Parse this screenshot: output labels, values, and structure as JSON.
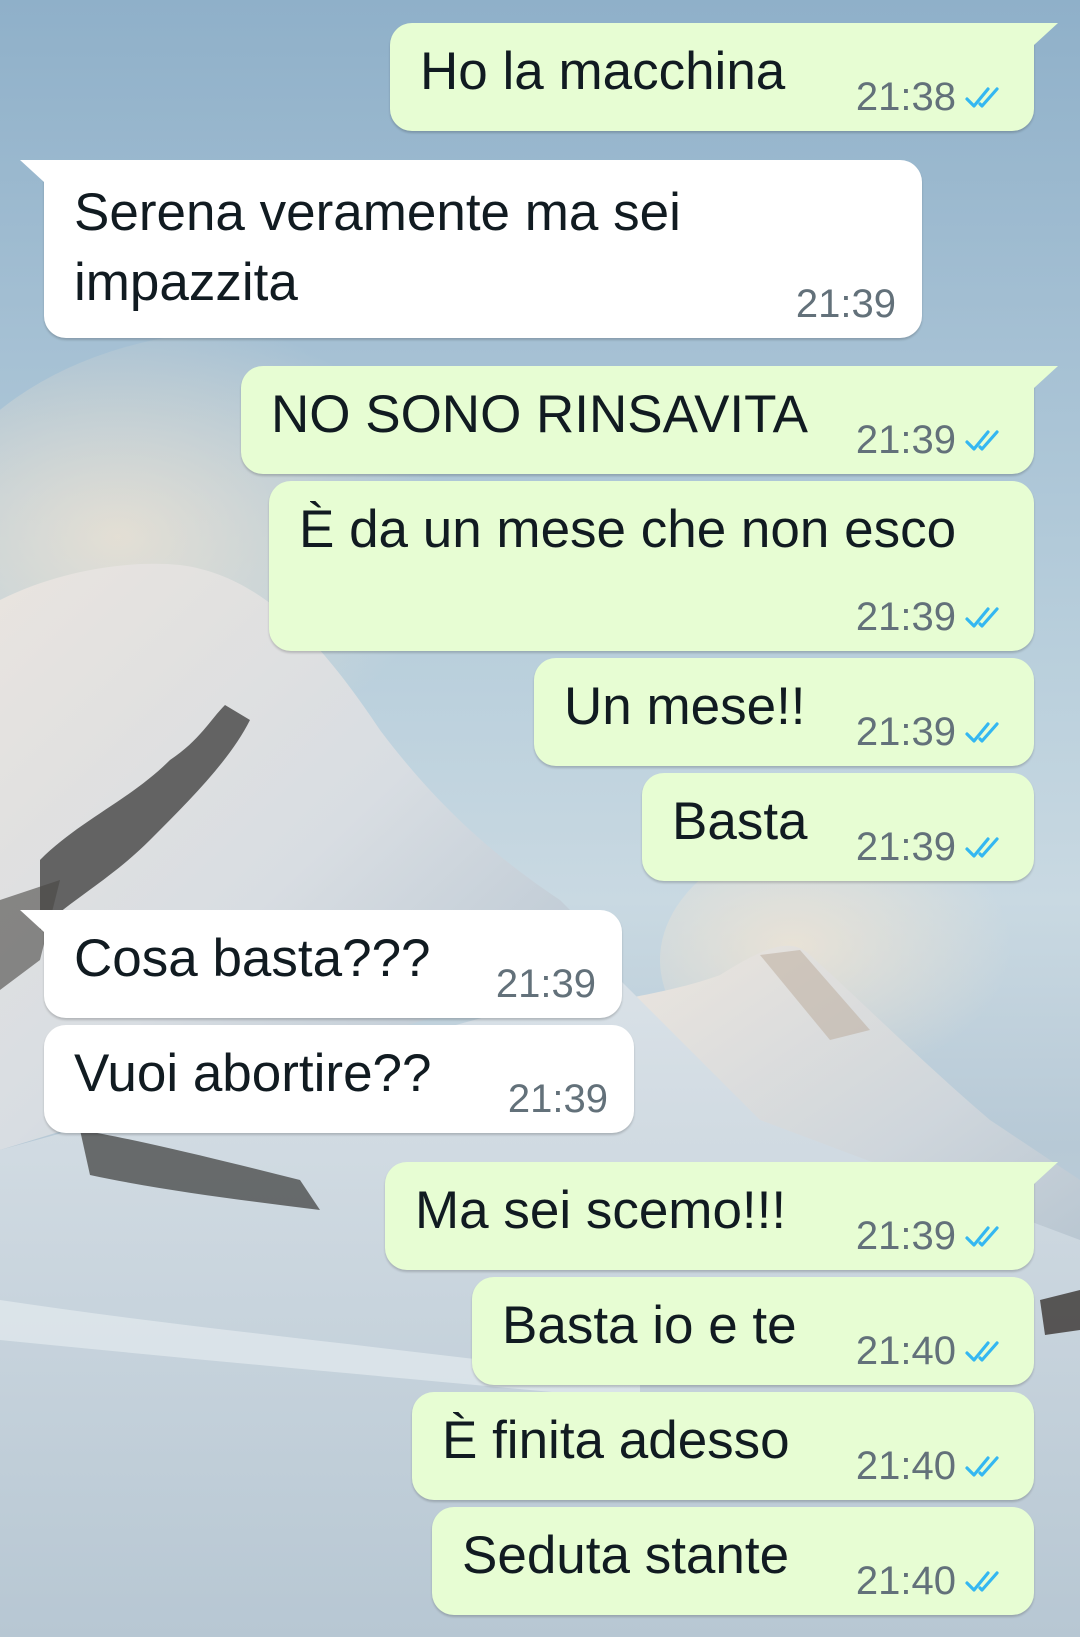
{
  "theme": {
    "outgoing_bubble_color": "#e7fdd3",
    "incoming_bubble_color": "#ffffff",
    "read_tick_color": "#34b7f1",
    "timestamp_color": "#63717a",
    "message_text_color": "#111b21"
  },
  "messages": [
    {
      "direction": "outgoing",
      "text": "Ho la macchina",
      "time": "21:38",
      "status_icon": "double-check-read-icon"
    },
    {
      "direction": "incoming",
      "text_lines": [
        "Serena veramente ma sei",
        "impazzita"
      ],
      "time": "21:39"
    },
    {
      "direction": "outgoing",
      "text": "NO SONO RINSAVITA",
      "time": "21:39",
      "status_icon": "double-check-read-icon"
    },
    {
      "direction": "outgoing",
      "text": "È da un mese che non esco",
      "time": "21:39",
      "status_icon": "double-check-read-icon"
    },
    {
      "direction": "outgoing",
      "text": "Un mese!!",
      "time": "21:39",
      "status_icon": "double-check-read-icon"
    },
    {
      "direction": "outgoing",
      "text": "Basta",
      "time": "21:39",
      "status_icon": "double-check-read-icon"
    },
    {
      "direction": "incoming",
      "text": "Cosa basta???",
      "time": "21:39"
    },
    {
      "direction": "incoming",
      "text": "Vuoi abortire??",
      "time": "21:39"
    },
    {
      "direction": "outgoing",
      "text": "Ma sei scemo!!!",
      "time": "21:39",
      "status_icon": "double-check-read-icon"
    },
    {
      "direction": "outgoing",
      "text": "Basta io e te",
      "time": "21:40",
      "status_icon": "double-check-read-icon"
    },
    {
      "direction": "outgoing",
      "text": "È finita adesso",
      "time": "21:40",
      "status_icon": "double-check-read-icon"
    },
    {
      "direction": "outgoing",
      "text": "Seduta stante",
      "time": "21:40",
      "status_icon": "double-check-read-icon"
    }
  ]
}
